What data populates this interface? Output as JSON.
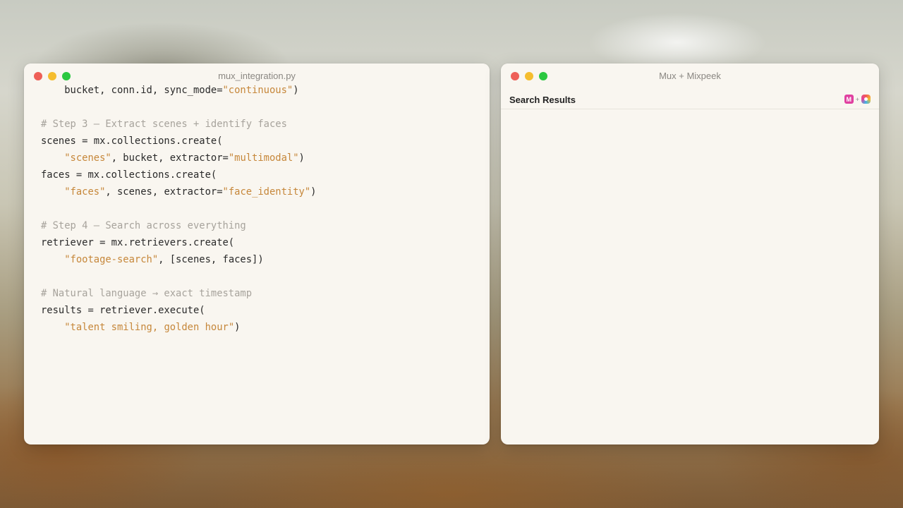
{
  "code_window": {
    "title": "mux_integration.py",
    "lines": [
      [
        {
          "t": "    bucket, conn.id, sync_mode=",
          "c": "plain"
        },
        {
          "t": "\"continuous\"",
          "c": "string"
        },
        {
          "t": ")",
          "c": "plain"
        }
      ],
      [
        {
          "t": "",
          "c": "plain"
        }
      ],
      [
        {
          "t": "# Step 3 — Extract scenes + identify faces",
          "c": "comment"
        }
      ],
      [
        {
          "t": "scenes = mx.collections.create(",
          "c": "plain"
        }
      ],
      [
        {
          "t": "    ",
          "c": "plain"
        },
        {
          "t": "\"scenes\"",
          "c": "string"
        },
        {
          "t": ", bucket, extractor=",
          "c": "plain"
        },
        {
          "t": "\"multimodal\"",
          "c": "string"
        },
        {
          "t": ")",
          "c": "plain"
        }
      ],
      [
        {
          "t": "faces = mx.collections.create(",
          "c": "plain"
        }
      ],
      [
        {
          "t": "    ",
          "c": "plain"
        },
        {
          "t": "\"faces\"",
          "c": "string"
        },
        {
          "t": ", scenes, extractor=",
          "c": "plain"
        },
        {
          "t": "\"face_identity\"",
          "c": "string"
        },
        {
          "t": ")",
          "c": "plain"
        }
      ],
      [
        {
          "t": "",
          "c": "plain"
        }
      ],
      [
        {
          "t": "# Step 4 — Search across everything",
          "c": "comment"
        }
      ],
      [
        {
          "t": "retriever = mx.retrievers.create(",
          "c": "plain"
        }
      ],
      [
        {
          "t": "    ",
          "c": "plain"
        },
        {
          "t": "\"footage-search\"",
          "c": "string"
        },
        {
          "t": ", [scenes, faces])",
          "c": "plain"
        }
      ],
      [
        {
          "t": "",
          "c": "plain"
        }
      ],
      [
        {
          "t": "# Natural language → exact timestamp",
          "c": "comment"
        }
      ],
      [
        {
          "t": "results = retriever.execute(",
          "c": "plain"
        }
      ],
      [
        {
          "t": "    ",
          "c": "plain"
        },
        {
          "t": "\"talent smiling, golden hour\"",
          "c": "string"
        },
        {
          "t": ")",
          "c": "plain"
        }
      ]
    ]
  },
  "results_window": {
    "title": "Mux + Mixpeek",
    "header": "Search Results",
    "mux_logo_letter": "M",
    "logo_plus": "+"
  },
  "colors": {
    "string": "#c6873a",
    "comment": "#a7a39c",
    "plain": "#2a2a2a"
  }
}
